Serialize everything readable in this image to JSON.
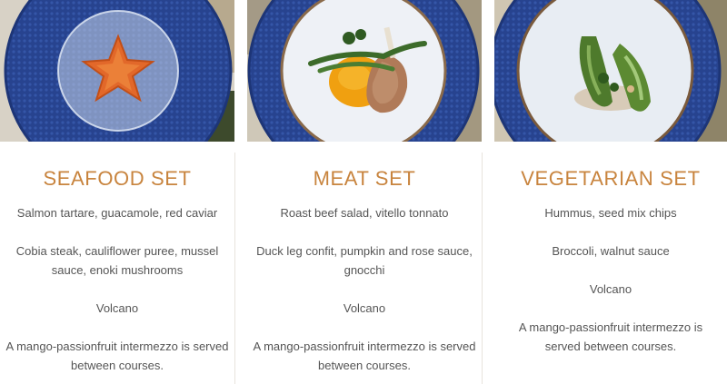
{
  "menu_sets": [
    {
      "title": "SEAFOOD SET",
      "photo_icon": "seafood-dish-photo",
      "courses": [
        "Salmon tartare, guacamole, red caviar",
        "Cobia steak, cauliflower puree, mussel sauce, enoki mushrooms",
        "Volcano",
        "A mango-passionfruit intermezzo is served between courses."
      ]
    },
    {
      "title": "MEAT SET",
      "photo_icon": "meat-dish-photo",
      "courses": [
        "Roast beef salad, vitello tonnato",
        "Duck leg confit, pumpkin and rose sauce, gnocchi",
        "Volcano",
        "A mango-passionfruit intermezzo is served between courses."
      ]
    },
    {
      "title": "VEGETARIAN SET",
      "photo_icon": "vegetarian-dish-photo",
      "courses": [
        "Hummus, seed mix chips",
        "Broccoli, walnut sauce",
        "Volcano",
        "A mango-passionfruit intermezzo is served between courses."
      ]
    }
  ],
  "colors": {
    "title": "#c8843e",
    "text": "#555555",
    "placemat": "#2b4a9a",
    "divider": "#e8e3dc"
  }
}
